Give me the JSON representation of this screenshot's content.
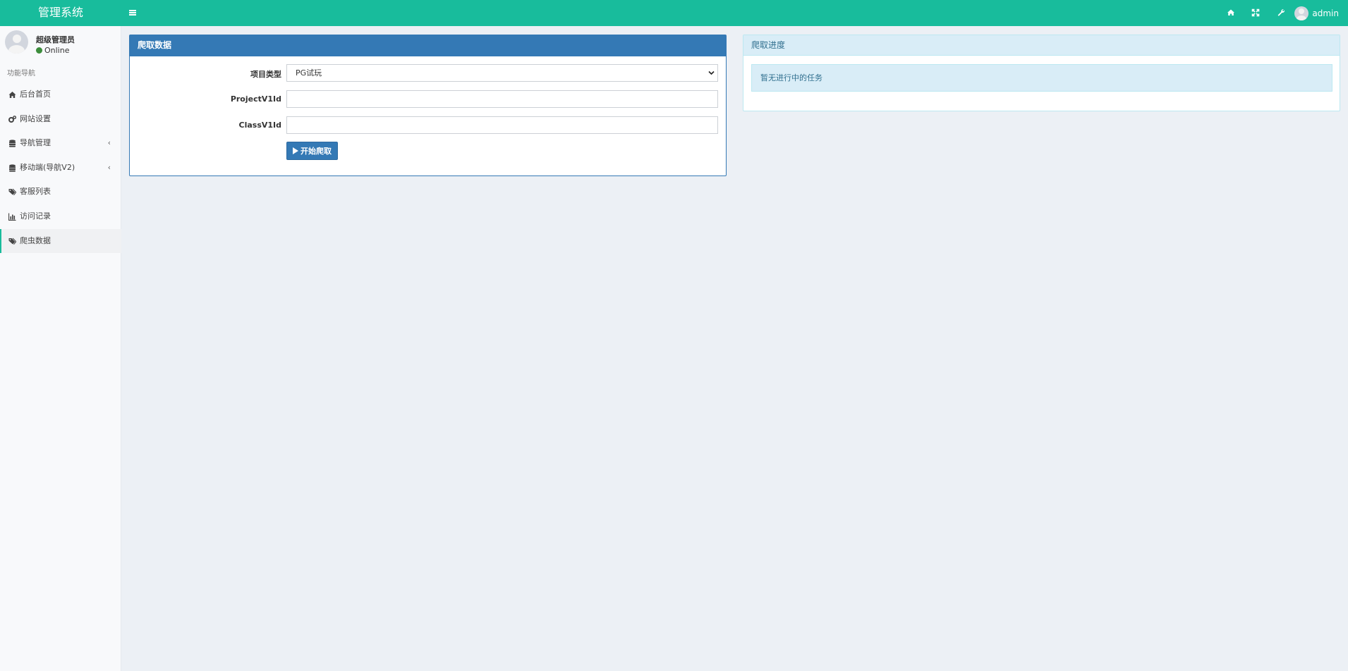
{
  "header": {
    "logo": "管理系统",
    "username": "admin"
  },
  "sidebar": {
    "user_name": "超级管理员",
    "user_status": "Online",
    "nav_header": "功能导航",
    "items": [
      {
        "label": "后台首页",
        "icon": "home-icon",
        "has_submenu": false
      },
      {
        "label": "网站设置",
        "icon": "cogs-icon",
        "has_submenu": false
      },
      {
        "label": "导航管理",
        "icon": "database-icon",
        "has_submenu": true
      },
      {
        "label": "移动端(导航V2)",
        "icon": "database-icon",
        "has_submenu": true
      },
      {
        "label": "客服列表",
        "icon": "tags-icon",
        "has_submenu": false
      },
      {
        "label": "访问记录",
        "icon": "bar-chart-icon",
        "has_submenu": false
      },
      {
        "label": "爬虫数据",
        "icon": "tags-icon",
        "has_submenu": false,
        "active": true
      }
    ],
    "chevron": "‹"
  },
  "crawl_panel": {
    "title": "爬取数据",
    "fields": {
      "project_type_label": "项目类型",
      "project_type_value": "PG试玩",
      "project_id_label": "ProjectV1Id",
      "project_id_value": "",
      "class_id_label": "ClassV1Id",
      "class_id_value": ""
    },
    "start_button": "开始爬取"
  },
  "progress_panel": {
    "title": "爬取进度",
    "message": "暂无进行中的任务"
  },
  "colors": {
    "header": "#18bc9c",
    "primary": "#3479b5",
    "info_bg": "#d9edf7",
    "info_text": "#31708f",
    "content_bg": "#ecf0f5"
  }
}
